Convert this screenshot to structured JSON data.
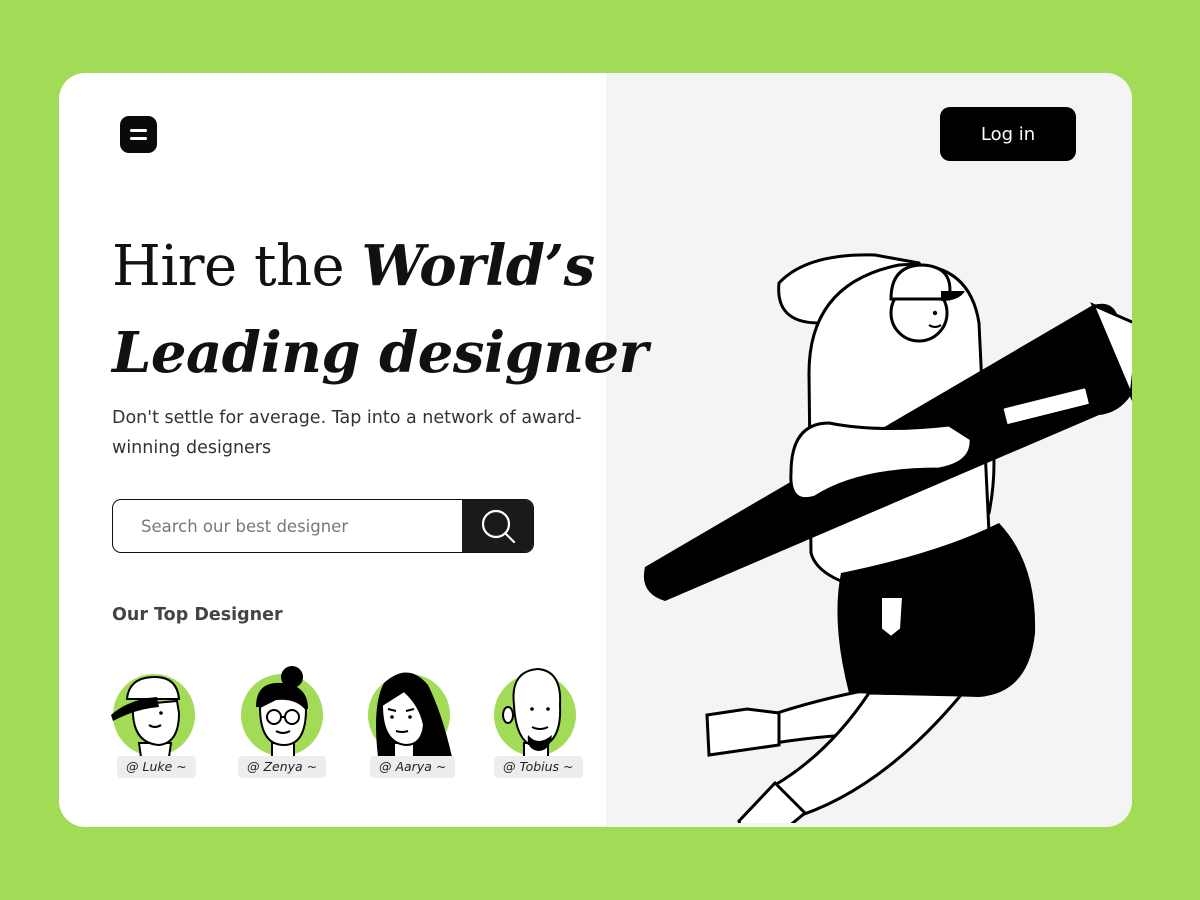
{
  "colors": {
    "accent": "#a2db55",
    "dark": "#0a0a0a",
    "panel": "#f4f4f4"
  },
  "header": {
    "menu_icon": "menu-icon",
    "login_label": "Log in"
  },
  "hero": {
    "title_plain": "Hire the ",
    "title_em1": "World’s",
    "title_em2": "Leading designer",
    "subtitle": "Don't settle for average. Tap into a network of award-winning designers"
  },
  "search": {
    "placeholder": "Search our best designer",
    "value": "",
    "icon": "search-icon"
  },
  "top_designers": {
    "title": "Our Top Designer",
    "items": [
      {
        "handle": "@ Luke ~"
      },
      {
        "handle": "@ Zenya ~"
      },
      {
        "handle": "@ Aarya ~"
      },
      {
        "handle": "@ Tobius  ~"
      }
    ]
  }
}
